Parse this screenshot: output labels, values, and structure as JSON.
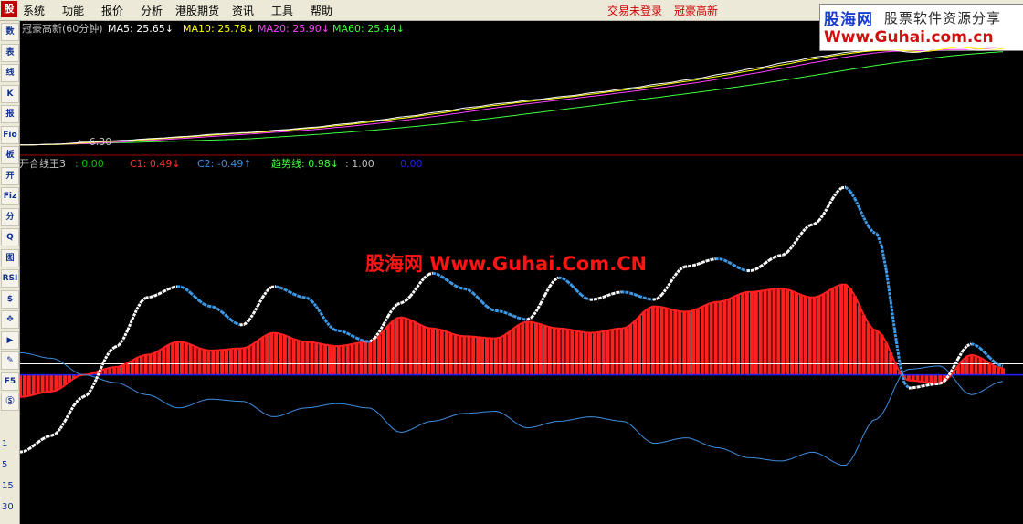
{
  "menu": {
    "logo": "股",
    "items": [
      "系统",
      "功能",
      "报价",
      "分析",
      "港股期货",
      "资讯",
      "工具",
      "帮助"
    ],
    "status_login": "交易未登录",
    "stock_name": "冠豪高新"
  },
  "watermark_box": {
    "site_cn": "股海网",
    "slogan": "股票软件资源分享",
    "url": "Www.Guhai.com.cn"
  },
  "center_watermark": "股海网 Www.Guhai.Com.CN",
  "toolbar": {
    "buttons": [
      "数",
      "表",
      "线",
      "K",
      "报",
      "Fio",
      "板",
      "开",
      "Fiz",
      "分",
      "Q",
      "图",
      "RSI",
      "$",
      "✥",
      "▶",
      "✎",
      "F5",
      "Ⓢ"
    ],
    "periods": [
      "1",
      "5",
      "15",
      "30"
    ]
  },
  "top_panel": {
    "title": "冠豪高新(60分钟)",
    "ma": [
      {
        "label": "MA5",
        "value": "25.65",
        "arrow": "↓",
        "color": "#ffffff"
      },
      {
        "label": "MA10",
        "value": "25.78",
        "arrow": "↓",
        "color": "#ffff00"
      },
      {
        "label": "MA20",
        "value": "25.90",
        "arrow": "↓",
        "color": "#ff40ff"
      },
      {
        "label": "MA60",
        "value": "25.44",
        "arrow": "↓",
        "color": "#40ff40"
      }
    ],
    "low_marker": "6.30"
  },
  "bottom_panel": {
    "title": "开合线王3",
    "fields": [
      {
        "label": ": ",
        "value": "0.00",
        "arrow": "",
        "color": "#00c000",
        "label_color": "#00c000"
      },
      {
        "label": "C1: ",
        "value": "0.49",
        "arrow": "↓",
        "color": "#ff3030",
        "label_color": "#ff3030"
      },
      {
        "label": "C2: ",
        "value": "-0.49",
        "arrow": "↑",
        "color": "#3d8ddf",
        "label_color": "#3d8ddf"
      },
      {
        "label": "趋势线: ",
        "value": "0.98",
        "arrow": "↓",
        "color": "#40ff40",
        "label_color": "#40ff40"
      },
      {
        "label": ": ",
        "value": "1.00",
        "arrow": "",
        "color": "#c0c0c0",
        "label_color": "#c0c0c0"
      },
      {
        "label": "",
        "value": "0.00",
        "arrow": "",
        "color": "#2020ff",
        "label_color": "#2020ff"
      }
    ]
  },
  "colors": {
    "up": "#ff2020",
    "down": "#00ffff",
    "trend_up": "#ffffff",
    "trend_down": "#3d9be9",
    "c1_line": "#ff2020",
    "c2_line": "#3d8ddf",
    "ma5": "#ffffff",
    "ma10": "#ffff00",
    "ma20": "#ff40ff",
    "ma60": "#40ff40",
    "baseline": "#2020ff",
    "ref_line": "#ffffff"
  },
  "chart_data": {
    "type": "line",
    "price_60min": [
      6.3,
      6.5,
      6.9,
      7.2,
      7.6,
      8.0,
      8.5,
      8.8,
      9.3,
      9.8,
      10.5,
      11.2,
      12.0,
      12.9,
      13.8,
      14.6,
      15.3,
      16.0,
      16.8,
      17.6,
      18.5,
      19.4,
      20.5,
      21.6,
      22.8,
      23.9,
      24.8,
      25.3,
      24.6,
      25.9,
      25.1,
      25.7
    ],
    "trend_line": [
      -0.7,
      -0.55,
      -0.2,
      0.25,
      0.7,
      0.8,
      0.62,
      0.45,
      0.8,
      0.7,
      0.4,
      0.3,
      0.65,
      0.92,
      0.78,
      0.58,
      0.5,
      0.88,
      0.68,
      0.75,
      0.68,
      0.98,
      1.05,
      0.94,
      1.08,
      1.36,
      1.7,
      1.28,
      -0.12,
      -0.08,
      0.28,
      0.08
    ],
    "c1": [
      -0.2,
      -0.15,
      0.0,
      0.07,
      0.18,
      0.3,
      0.22,
      0.24,
      0.38,
      0.3,
      0.26,
      0.3,
      0.52,
      0.42,
      0.35,
      0.33,
      0.48,
      0.42,
      0.38,
      0.42,
      0.62,
      0.57,
      0.66,
      0.75,
      0.78,
      0.7,
      0.82,
      0.4,
      -0.05,
      -0.08,
      0.18,
      0.06
    ],
    "c2": [
      0.2,
      0.15,
      0.0,
      -0.07,
      -0.18,
      -0.3,
      -0.22,
      -0.24,
      -0.38,
      -0.3,
      -0.26,
      -0.3,
      -0.52,
      -0.42,
      -0.35,
      -0.33,
      -0.48,
      -0.42,
      -0.38,
      -0.42,
      -0.62,
      -0.57,
      -0.66,
      -0.75,
      -0.78,
      -0.7,
      -0.82,
      -0.4,
      0.05,
      0.08,
      -0.18,
      -0.06
    ],
    "reference_levels": [
      0.0,
      0.1
    ]
  }
}
